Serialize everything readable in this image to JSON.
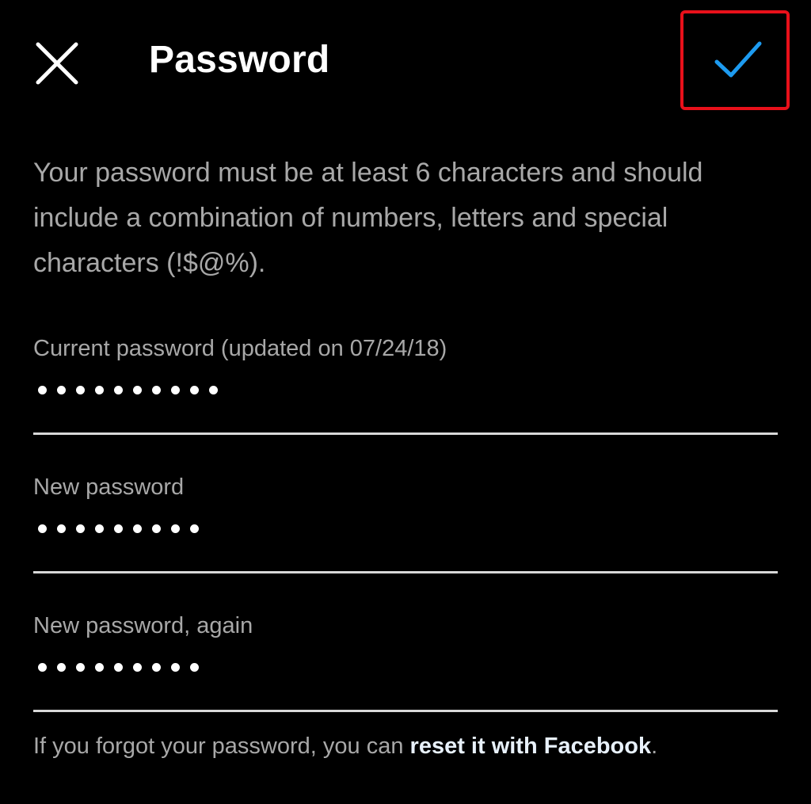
{
  "header": {
    "title": "Password",
    "close_icon": "close-icon",
    "confirm_icon": "checkmark-icon",
    "confirm_color": "#1d9bf0",
    "highlight_color": "#e8101a"
  },
  "requirements_text": "Your password must be at least 6 characters and should include a combination of numbers, letters and special characters (!$@%).",
  "fields": [
    {
      "label": "Current password (updated on 07/24/18)",
      "masked_length": 10
    },
    {
      "label": "New password",
      "masked_length": 9
    },
    {
      "label": "New password, again",
      "masked_length": 9
    }
  ],
  "footer": {
    "prefix": "If you forgot your password, you can ",
    "link_text": "reset it with Facebook",
    "suffix": "."
  }
}
